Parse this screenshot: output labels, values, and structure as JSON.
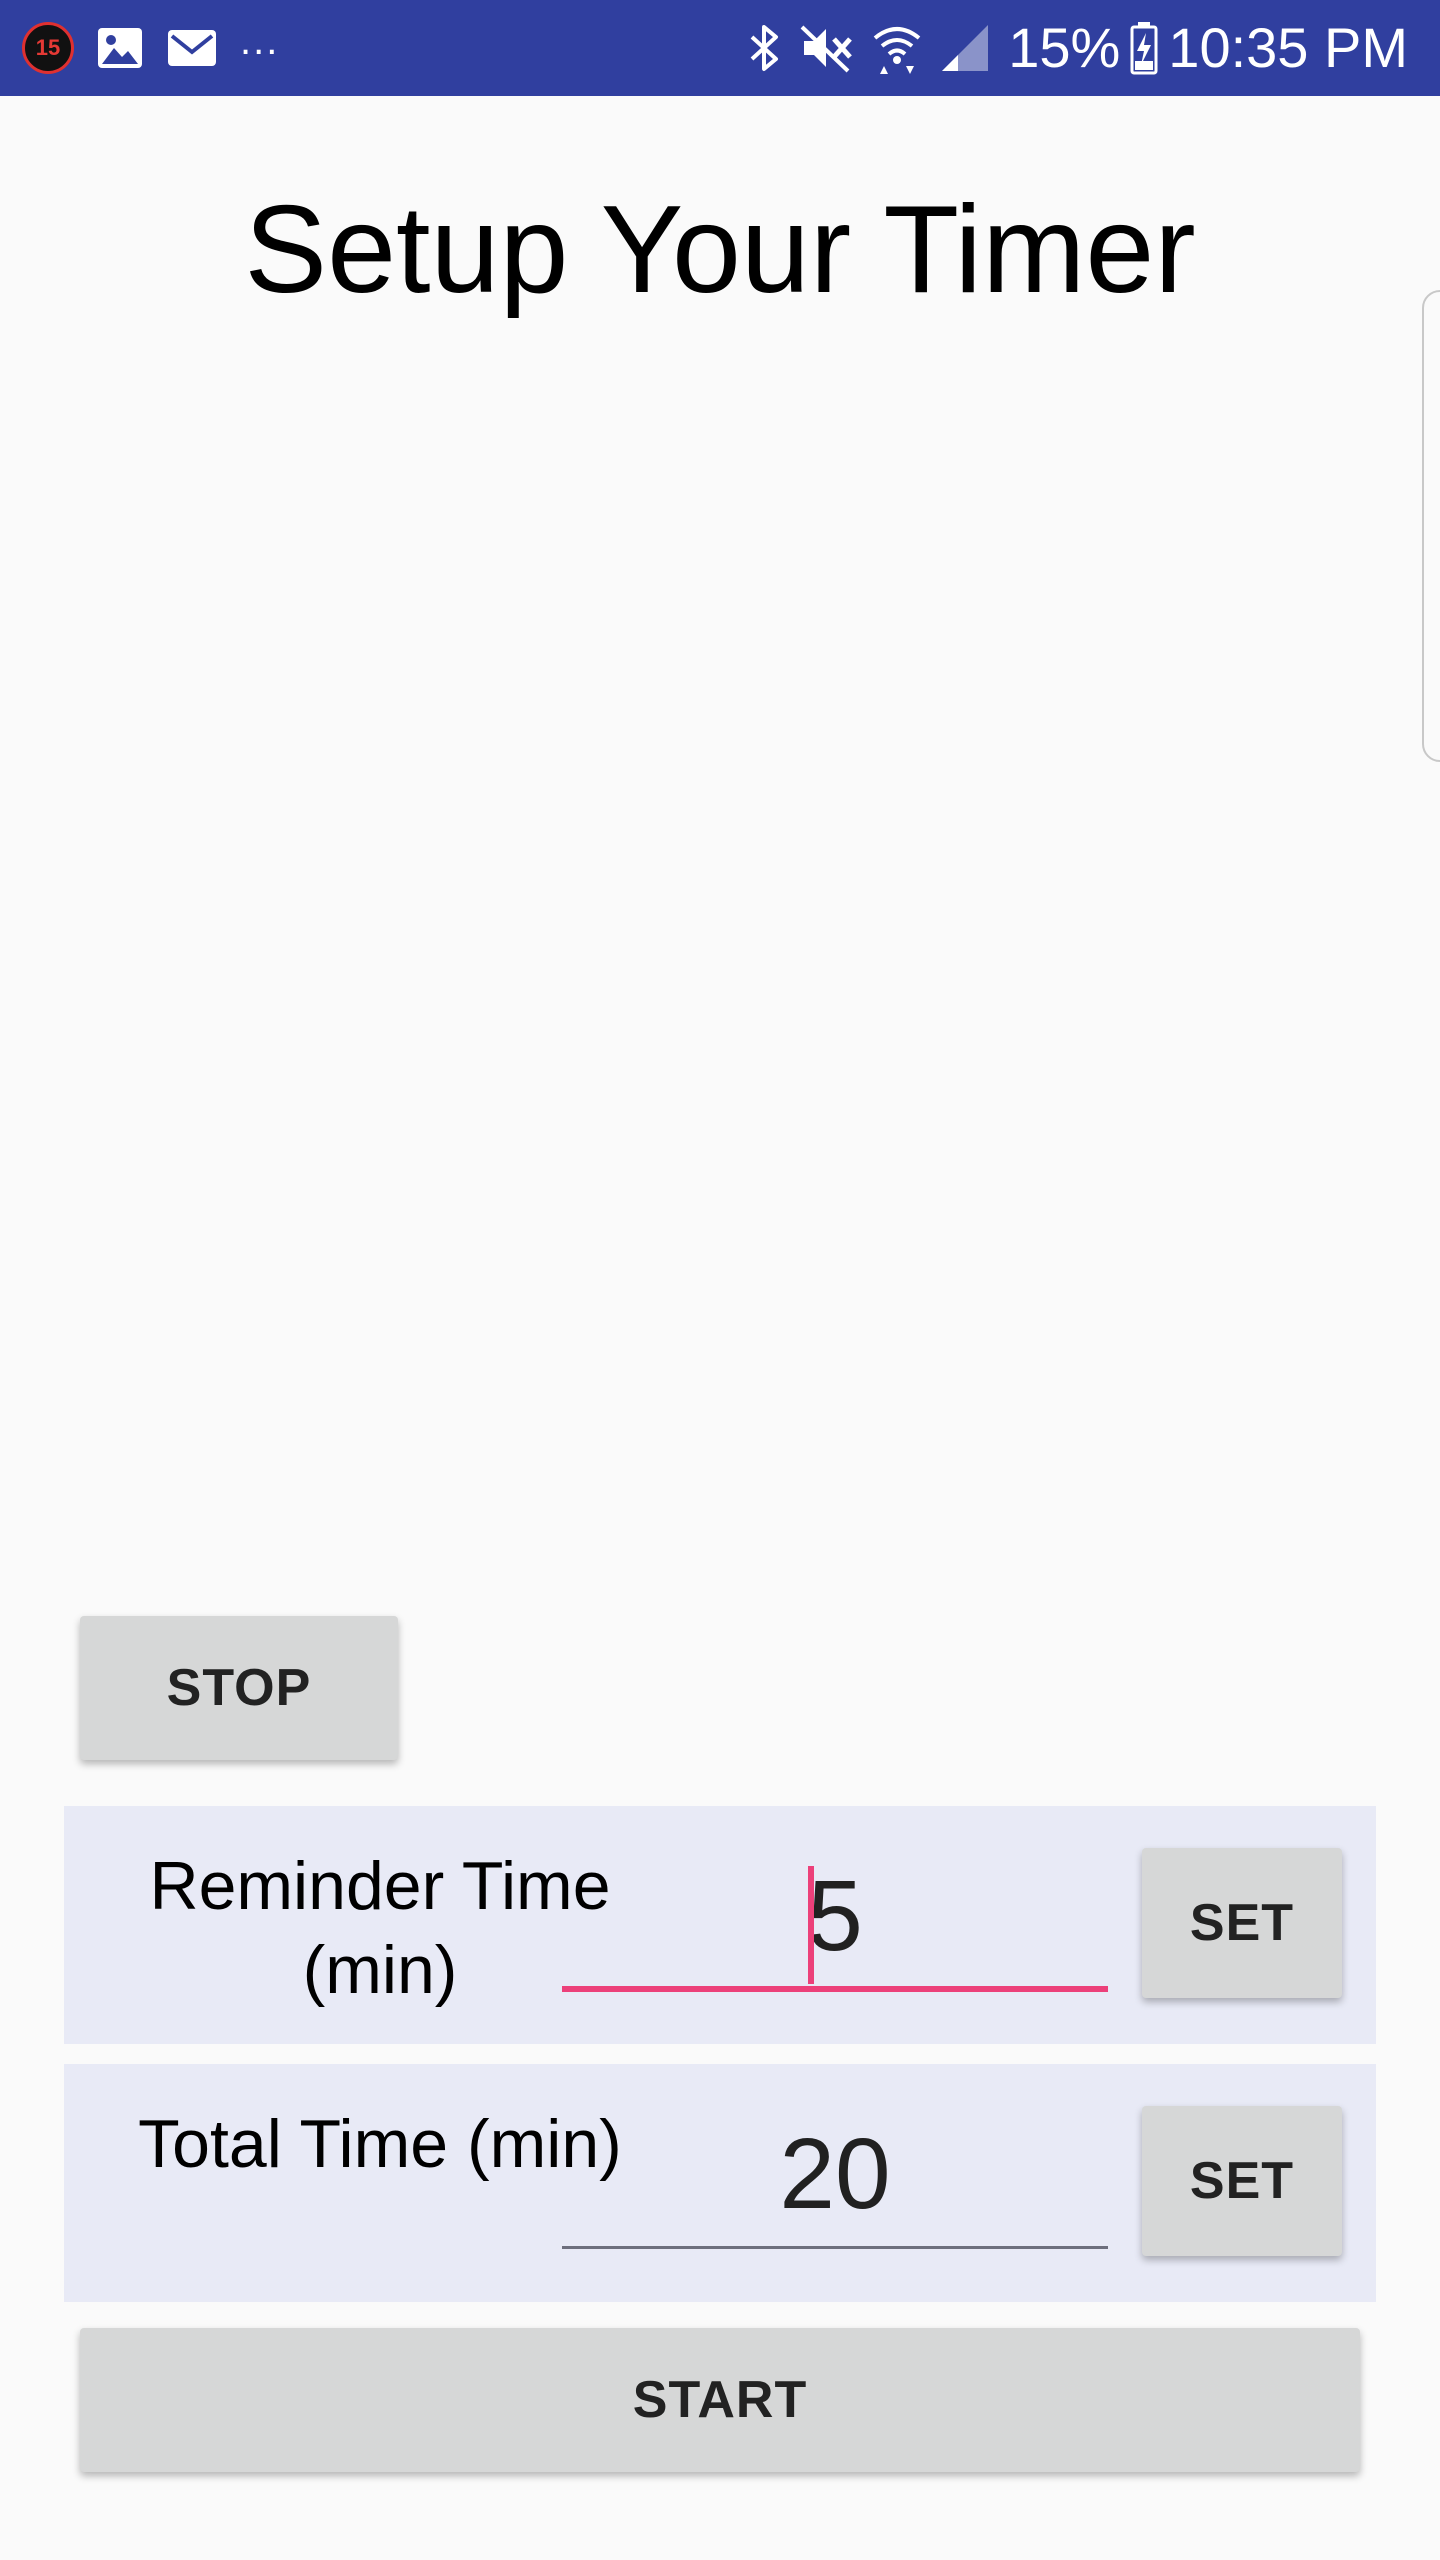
{
  "status_bar": {
    "notification_count": "15",
    "overflow": "...",
    "battery_percent": "15%",
    "time": "10:35 PM",
    "icons_left": [
      "notification-count-icon",
      "image-icon",
      "mail-icon"
    ],
    "icons_right": [
      "bluetooth-icon",
      "mute-icon",
      "wifi-icon",
      "cell-signal-icon",
      "battery-charging-icon"
    ],
    "background": "#303f9f"
  },
  "main": {
    "title": "Setup Your Timer"
  },
  "controls": {
    "stop_label": "STOP",
    "start_label": "START"
  },
  "reminder": {
    "label": "Reminder Time (min)",
    "value": "5",
    "set_label": "SET"
  },
  "total": {
    "label": "Total Time (min)",
    "value": "20",
    "set_label": "SET"
  },
  "colors": {
    "accent": "#ec407a",
    "primary_dark": "#303f9f",
    "row_background": "#e8eaf6",
    "button_background": "#d6d7d7"
  }
}
